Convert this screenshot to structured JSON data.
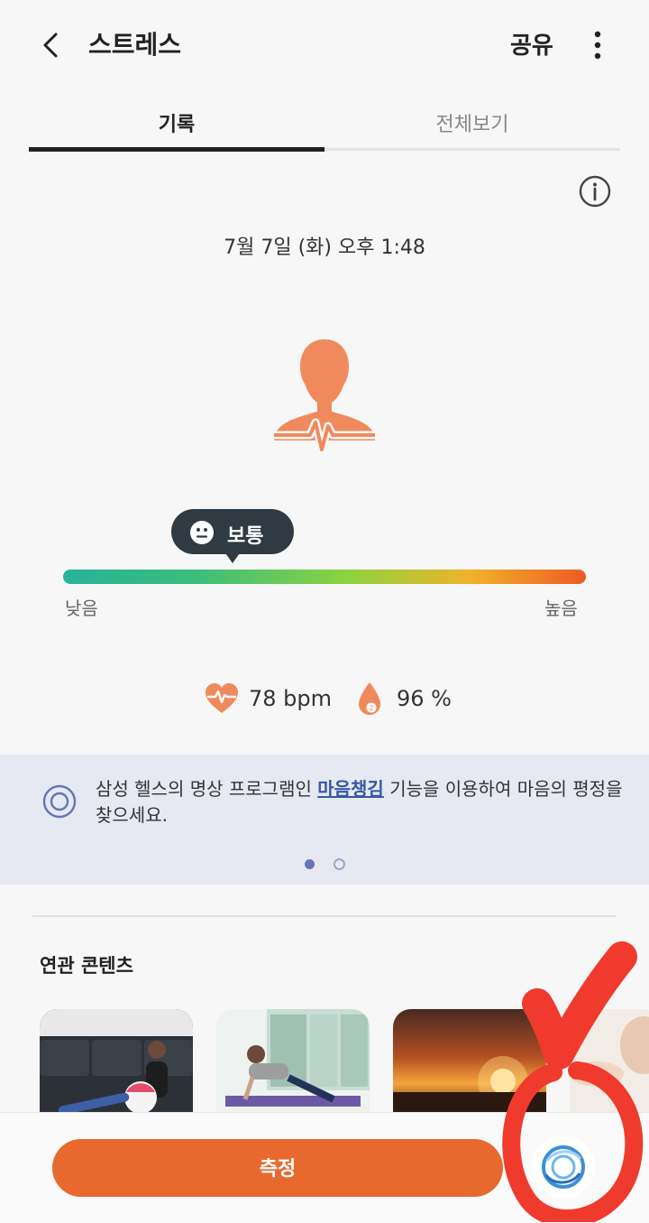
{
  "header": {
    "title": "스트레스",
    "share_label": "공유"
  },
  "tabs": [
    {
      "label": "기록",
      "active": true
    },
    {
      "label": "전체보기",
      "active": false
    }
  ],
  "record": {
    "timestamp": "7월 7일 (화) 오후 1:48",
    "stress_level_label": "보통",
    "stress_level_position": 0.32,
    "scale_low_label": "낮음",
    "scale_high_label": "높음"
  },
  "vitals": {
    "heart_rate": "78 bpm",
    "spo2": "96 %"
  },
  "banner": {
    "text_before": "삼성 헬스의 명상 프로그램인 ",
    "link_text": "마음챙김",
    "text_after": " 기능을 이용하여 마음의 평정을 찾으세요.",
    "page_index": 0,
    "page_count": 2
  },
  "related": {
    "title": "연관 콘텐츠"
  },
  "bottom": {
    "measure_label": "측정"
  },
  "icons": {
    "back": "back-arrow-icon",
    "more": "more-vertical-icon",
    "info": "info-icon",
    "stress_figure": "stress-person-icon",
    "face": "neutral-face-icon",
    "heart": "heart-rate-icon",
    "oxygen": "spo2-drop-icon",
    "mindfulness": "mindfulness-target-icon",
    "bixby": "bixby-icon"
  },
  "colors": {
    "accent": "#e8692d",
    "figure": "#f08a5d",
    "bubble": "#2f3a42",
    "link": "#3458a4",
    "annotation": "#f03a2e"
  }
}
